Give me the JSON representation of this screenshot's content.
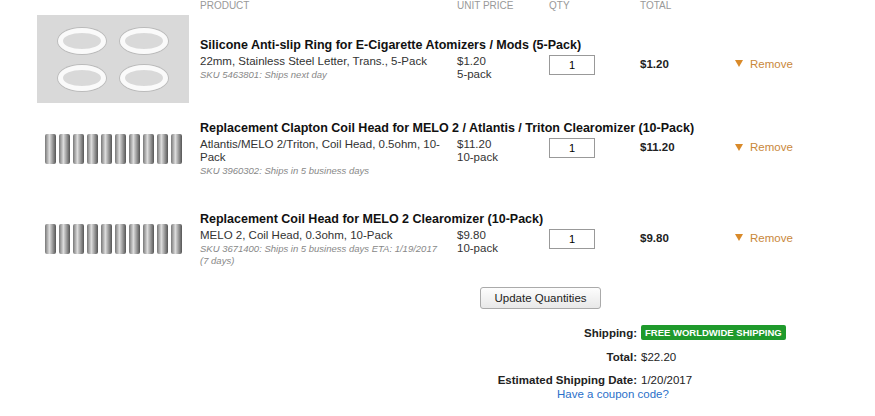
{
  "columns": [
    "PRODUCT",
    "UNIT PRICE",
    "QTY",
    "TOTAL"
  ],
  "items": [
    {
      "kind": "rings",
      "title": "Silicone Anti-slip Ring for E-Cigarette Atomizers / Mods (5-Pack)",
      "option": "22mm, Stainless Steel Letter, Trans., 5-Pack",
      "sku": "SKU 5463801: Ships next day",
      "unit_price": "$1.20",
      "pack": "5-pack",
      "qty": "1",
      "total": "$1.20",
      "remove": "Remove"
    },
    {
      "kind": "coils",
      "title": "Replacement Clapton Coil Head for MELO 2 / Atlantis / Triton Clearomizer (10-Pack)",
      "option": "Atlantis/MELO 2/Triton, Coil Head, 0.5ohm, 10-Pack",
      "sku": "SKU 3960302: Ships in 5 business days",
      "unit_price": "$11.20",
      "pack": "10-pack",
      "qty": "1",
      "total": "$11.20",
      "remove": "Remove"
    },
    {
      "kind": "coils",
      "title": "Replacement Coil Head for MELO 2 Clearomizer (10-Pack)",
      "option": "MELO 2, Coil Head, 0.3ohm, 10-Pack",
      "sku": "SKU 3671400: Ships in 5 business days ETA: 1/19/2017 (7 days)",
      "unit_price": "$9.80",
      "pack": "10-pack",
      "qty": "1",
      "total": "$9.80",
      "remove": "Remove"
    }
  ],
  "update_button": "Update Quantities",
  "summary": {
    "shipping_label": "Shipping:",
    "shipping_badge": "FREE WORLDWIDE SHIPPING",
    "total_label": "Total:",
    "total": "$22.20",
    "date_label": "Estimated Shipping Date:",
    "date": "1/20/2017"
  },
  "coupon_link": "Have a coupon code?"
}
